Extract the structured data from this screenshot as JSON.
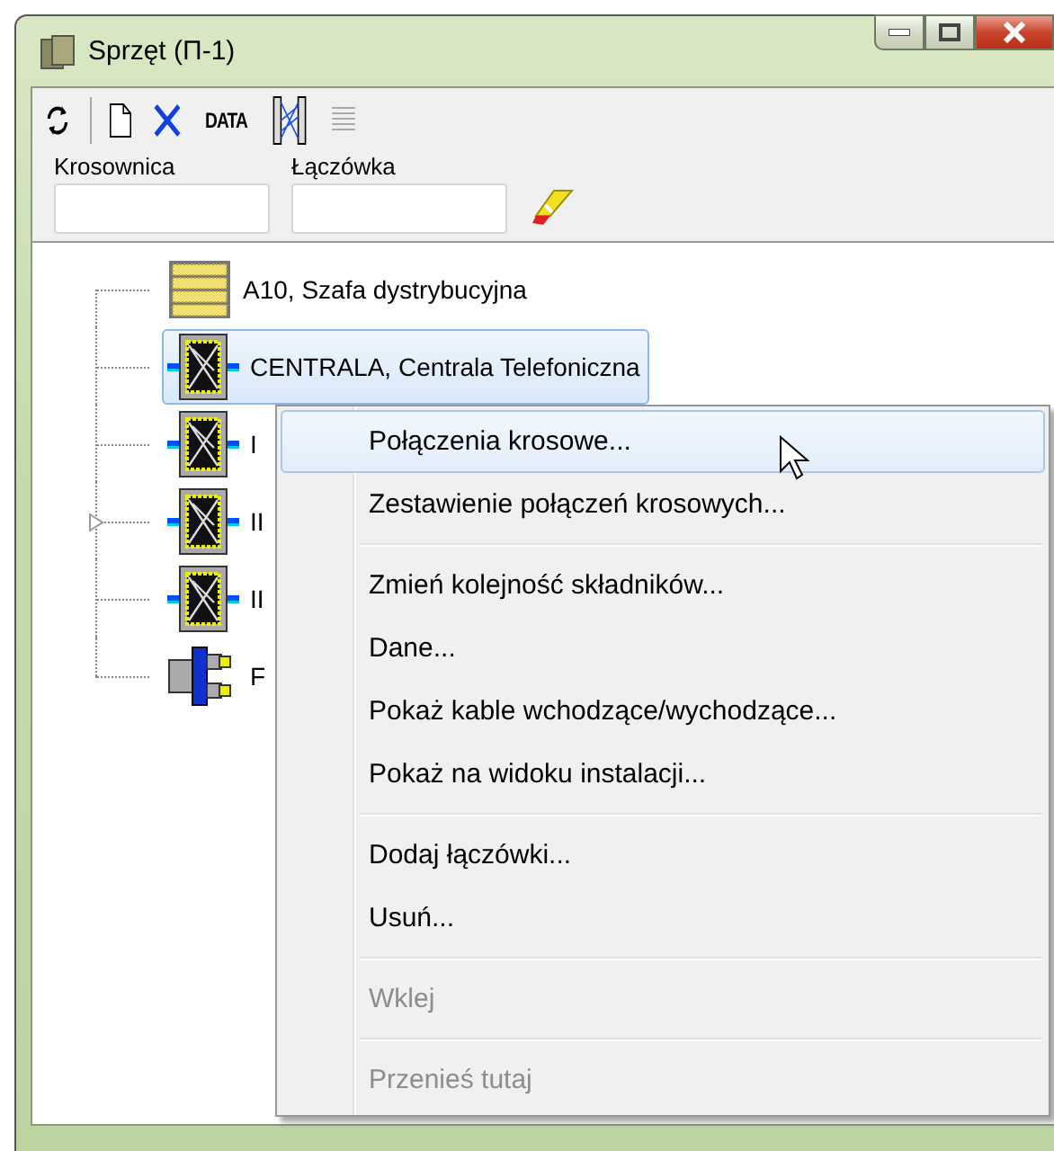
{
  "window": {
    "title": "Sprzęt (Π-1)"
  },
  "toolbar": [
    {
      "kind": "refresh",
      "disabled": false
    },
    {
      "kind": "new",
      "disabled": false
    },
    {
      "kind": "delete",
      "disabled": false
    },
    {
      "kind": "data",
      "label": "DATA",
      "disabled": false
    },
    {
      "kind": "crossconnect",
      "disabled": false
    },
    {
      "kind": "list",
      "disabled": true
    }
  ],
  "filters": [
    {
      "label": "Krosownica"
    },
    {
      "label": "Łączówka"
    }
  ],
  "tree": {
    "rows": [
      {
        "label": "A10, Szafa dystrybucyjna",
        "kind": "cabinet",
        "selected": false,
        "collapsed": false
      },
      {
        "label": "CENTRALA, Centrala Telefoniczna",
        "kind": "patch",
        "selected": true,
        "collapsed": false
      },
      {
        "label": "I",
        "kind": "patch",
        "selected": false,
        "collapsed": false
      },
      {
        "label": "II",
        "kind": "patch",
        "selected": false,
        "collapsed": true
      },
      {
        "label": "II",
        "kind": "patch",
        "selected": false,
        "collapsed": false
      },
      {
        "label": "F",
        "kind": "connector",
        "selected": false,
        "collapsed": false
      }
    ]
  },
  "context_menu": [
    {
      "kind": "item",
      "label": "Połączenia krosowe...",
      "selected": true,
      "disabled": false
    },
    {
      "kind": "item",
      "label": "Zestawienie połączeń krosowych...",
      "selected": false,
      "disabled": false
    },
    {
      "kind": "separator"
    },
    {
      "kind": "item",
      "label": "Zmień kolejność składników...",
      "selected": false,
      "disabled": false
    },
    {
      "kind": "item",
      "label": "Dane...",
      "selected": false,
      "disabled": false
    },
    {
      "kind": "item",
      "label": "Pokaż kable wchodzące/wychodzące...",
      "selected": false,
      "disabled": false
    },
    {
      "kind": "item",
      "label": "Pokaż na widoku instalacji...",
      "selected": false,
      "disabled": false
    },
    {
      "kind": "separator"
    },
    {
      "kind": "item",
      "label": "Dodaj łączówki...",
      "selected": false,
      "disabled": false
    },
    {
      "kind": "item",
      "label": "Usuń...",
      "selected": false,
      "disabled": false
    },
    {
      "kind": "separator"
    },
    {
      "kind": "item",
      "label": "Wklej",
      "selected": false,
      "disabled": true
    },
    {
      "kind": "separator"
    },
    {
      "kind": "item",
      "label": "Przenieś tutaj",
      "selected": false,
      "disabled": true
    }
  ]
}
